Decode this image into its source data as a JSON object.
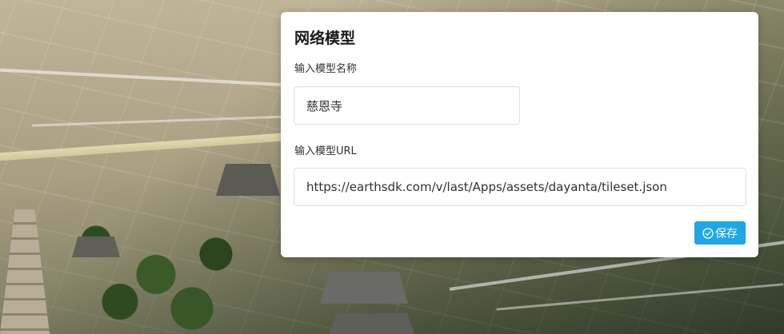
{
  "dialog": {
    "title": "网络模型",
    "name_label": "输入模型名称",
    "name_value": "慈恩寺",
    "url_label": "输入模型URL",
    "url_value": "https://earthsdk.com/v/last/Apps/assets/dayanta/tileset.json",
    "save_label": "保存",
    "save_icon": "check-circle-icon"
  },
  "colors": {
    "accent": "#1ea6e7",
    "panel_bg": "#ffffff",
    "input_border": "#dcdfe6"
  }
}
